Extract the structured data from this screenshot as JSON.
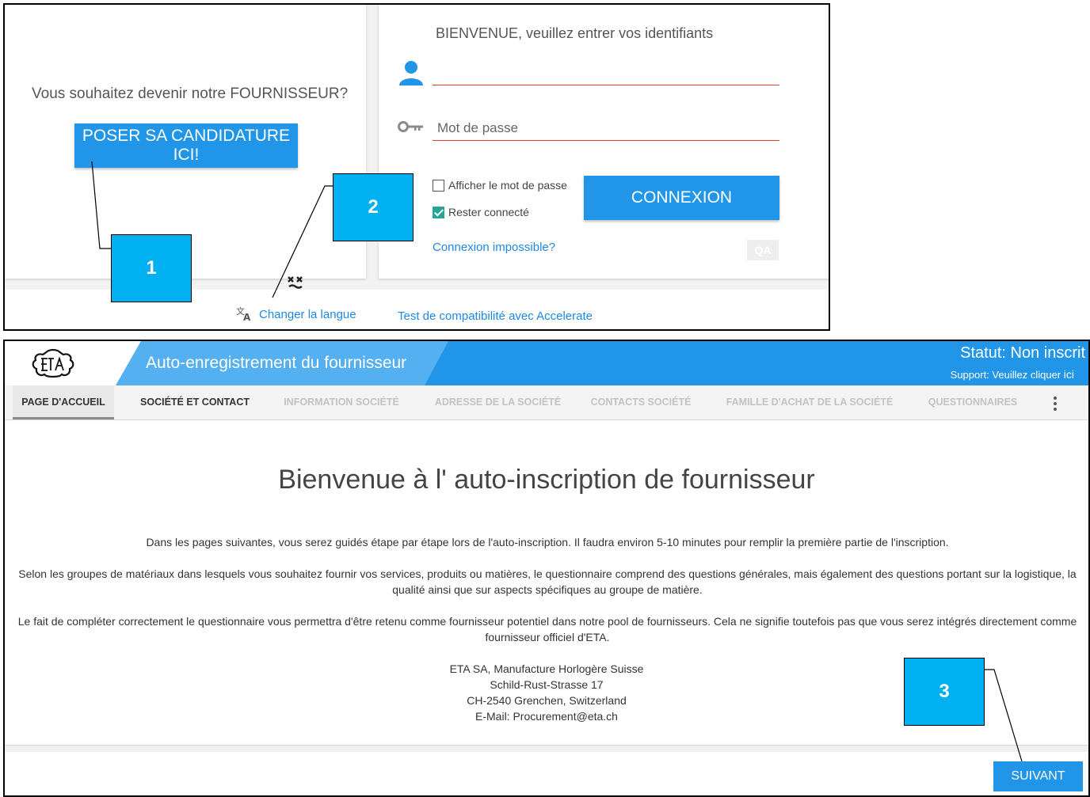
{
  "login_screen": {
    "supplier_question": "Vous souhaitez devenir notre FOURNISSEUR?",
    "apply_button": "POSER SA CANDIDATURE ICI!",
    "welcome": "BIENVENUE, veuillez entrer vos identifiants",
    "username_value": "",
    "password_placeholder": "Mot de passe",
    "show_password_label": "Afficher le mot de passe",
    "show_password_checked": false,
    "stay_connected_label": "Rester connecté",
    "stay_connected_checked": true,
    "login_button": "CONNEXION",
    "cant_login_link": "Connexion impossible?",
    "qa_badge": "QA",
    "change_language_link": "Changer la langue",
    "compat_test_link": "Test de compatibilité avec Accelerate"
  },
  "callouts": [
    "1",
    "2",
    "3"
  ],
  "registration": {
    "title": "Auto-enregistrement du fournisseur",
    "status": "Statut: Non inscrit",
    "support_prefix": "Support: Veuillez cliquer",
    "support_link": "ici",
    "tabs": [
      {
        "label": "PAGE D'ACCUEIL",
        "state": "active"
      },
      {
        "label": "SOCIÉTÉ ET CONTACT",
        "state": "enabled"
      },
      {
        "label": "INFORMATION SOCIÉTÉ",
        "state": "disabled"
      },
      {
        "label": "ADRESSE DE LA SOCIÉTÉ",
        "state": "disabled"
      },
      {
        "label": "CONTACTS SOCIÉTÉ",
        "state": "disabled"
      },
      {
        "label": "FAMILLE D'ACHAT DE LA SOCIÉTÉ",
        "state": "disabled"
      },
      {
        "label": "QUESTIONNAIRES",
        "state": "disabled"
      }
    ],
    "welcome_title": "Bienvenue à l' auto-inscription de fournisseur",
    "paragraphs": [
      "Dans les pages suivantes, vous serez guidés étape par étape lors de l'auto-inscription. Il faudra environ 5-10 minutes pour remplir la première partie de l'inscription.",
      "Selon les groupes de matériaux dans lesquels vous souhaitez fournir vos services, produits ou matières, le questionnaire comprend des questions générales, mais également des questions portant sur la logistique, la qualité ainsi que sur aspects spécifiques au groupe de matière.",
      "Le fait de compléter correctement le questionnaire vous permettra d'être retenu comme fournisseur potentiel dans notre pool de fournisseurs. Cela ne signifie toutefois pas que vous serez intégrés directement comme fournisseur officiel d'ETA."
    ],
    "address_lines": [
      "ETA SA, Manufacture Horlogère Suisse",
      "Schild-Rust-Strasse 17",
      "CH-2540 Grenchen, Switzerland",
      "E-Mail: Procurement@eta.ch"
    ],
    "next_button": "SUIVANT"
  },
  "colors": {
    "accent": "#2196e8",
    "callout": "#00b0f0",
    "error_underline": "#e53935",
    "link": "#1e88e5",
    "checkbox_checked": "#26a69a"
  },
  "icons": [
    "user-icon",
    "key-icon",
    "translate-icon",
    "eta-logo",
    "more-vert-icon"
  ]
}
